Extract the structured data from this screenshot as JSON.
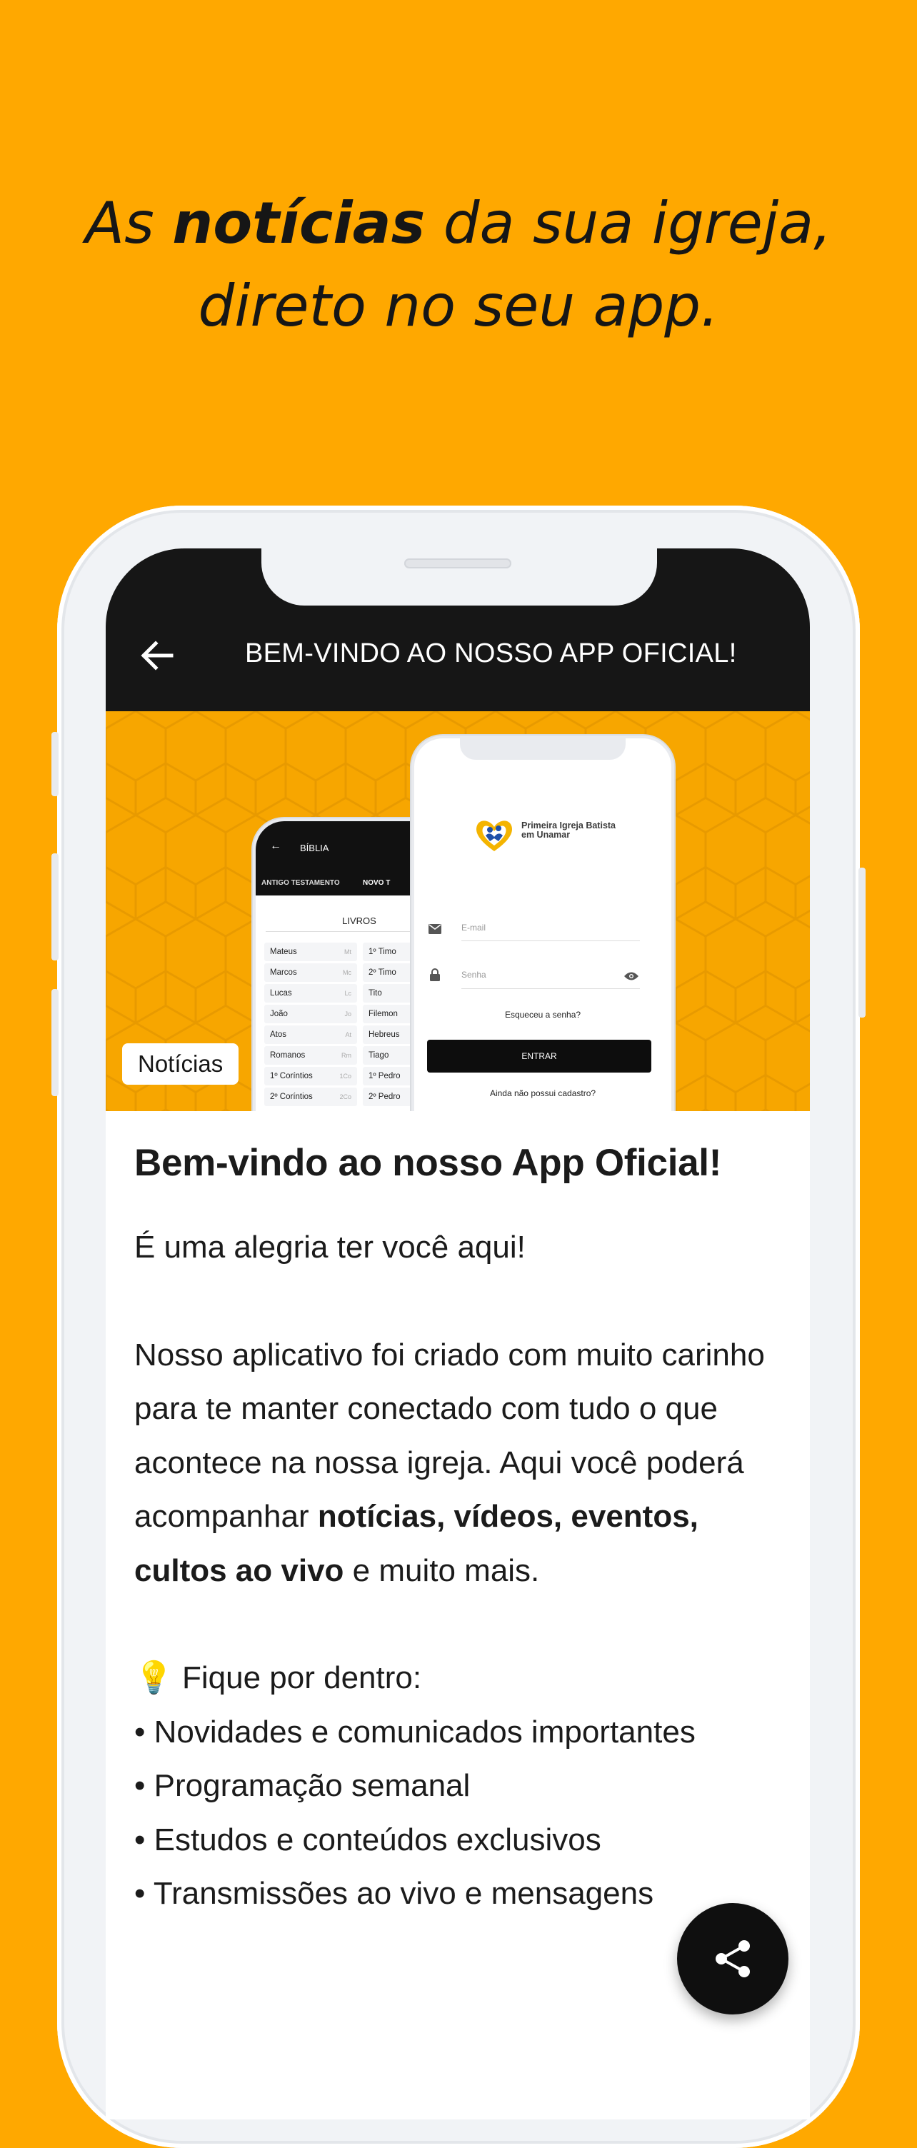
{
  "headline": {
    "pre": "As ",
    "bold": "notícias",
    "post": " da sua igreja,",
    "line2": "direto no seu app."
  },
  "appbar": {
    "title": "BEM-VINDO AO NOSSO APP OFICIAL!",
    "back_icon": "arrow-left-icon"
  },
  "banner": {
    "badge": "Notícias",
    "bible_screen": {
      "title": "BÍBLIA",
      "tab_old": "ANTIGO TESTAMENTO",
      "tab_new": "NOVO T",
      "section": "LIVROS",
      "books_left": [
        {
          "name": "Mateus",
          "abbr": "Mt"
        },
        {
          "name": "Marcos",
          "abbr": "Mc"
        },
        {
          "name": "Lucas",
          "abbr": "Lc"
        },
        {
          "name": "João",
          "abbr": "Jo"
        },
        {
          "name": "Atos",
          "abbr": "At"
        },
        {
          "name": "Romanos",
          "abbr": "Rm"
        },
        {
          "name": "1º Coríntios",
          "abbr": "1Co"
        },
        {
          "name": "2º Coríntios",
          "abbr": "2Co"
        }
      ],
      "books_right": [
        "1º Timo",
        "2º Timo",
        "Tito",
        "Filemon",
        "Hebreus",
        "Tiago",
        "1º Pedro",
        "2º Pedro"
      ]
    },
    "login_screen": {
      "logo_text": "Primeira Igreja Batista em Unamar",
      "email_placeholder": "E-mail",
      "password_placeholder": "Senha",
      "forgot": "Esqueceu a senha?",
      "enter_button": "ENTRAR",
      "register": "Ainda não possui cadastro?"
    }
  },
  "post": {
    "title": "Bem-vindo ao nosso App Oficial!",
    "greeting": "É uma alegria ter você aqui!",
    "body_pre": "Nosso aplicativo foi criado com muito carinho para te manter conectado com tudo o que acontece na nossa igreja. Aqui você poderá acompanhar ",
    "body_bold": "notícias, vídeos, eventos, cultos ao vivo",
    "body_post": " e muito mais.",
    "list_intro": "💡 Fique por dentro:",
    "list": [
      "• Novidades e comunicados importantes",
      "• Programação semanal",
      "• Estudos e conteúdos exclusivos",
      "• Transmissões ao vivo e mensagens"
    ]
  },
  "fab": {
    "icon": "share-icon"
  },
  "colors": {
    "background": "#FFA800",
    "appbar": "#161616",
    "banner": "#F7A600"
  }
}
